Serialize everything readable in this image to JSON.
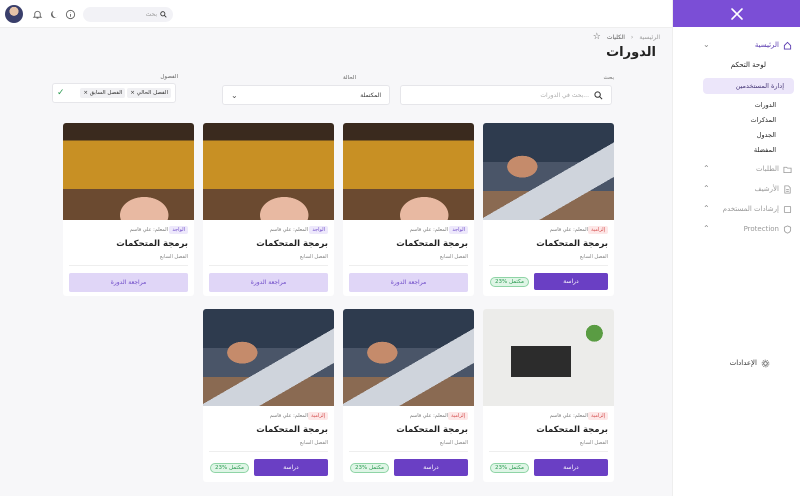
{
  "header": {
    "search_placeholder": "بحث",
    "icons": [
      "avatar",
      "bell-icon",
      "moon-icon",
      "info-icon",
      "search-icon"
    ]
  },
  "sidebar": {
    "home": "الرئيسية",
    "dashboard": "لوحة التحكم",
    "user_management": "إدارة المستخدمين",
    "sub_items": [
      "الدورات",
      "المذكرات",
      "الجدول",
      "المفضلة"
    ],
    "groups": [
      "الطلبات",
      "الأرشيف",
      "إرشادات المستخدم",
      "Protection"
    ],
    "settings": "الإعدادات"
  },
  "breadcrumb": [
    "الرئيسية",
    "الكليات"
  ],
  "page_title": "الدورات",
  "filters": {
    "search_label": "بحث",
    "search_placeholder": "بحث في الدورات...",
    "status_label": "الحالة",
    "status_value": "المكتملة",
    "season_label": "الفصول",
    "season_chips": [
      "الفصل الحالي",
      "الفصل السابق"
    ]
  },
  "cards": [
    {
      "badge": "إلزامية",
      "badge_type": "required",
      "teacher": "المعلم: علي قاسم",
      "title": "برمجة المتحكمات",
      "season": "الفصل السابع",
      "mode": "study",
      "button": "دراسة",
      "progress": "23% مكتمل",
      "image": "meeting"
    },
    {
      "badge": "الواجد",
      "badge_type": "completed",
      "teacher": "المعلم: علي قاسم",
      "title": "برمجة المتحكمات",
      "season": "الفصل السابع",
      "mode": "review",
      "button": "مراجعة الدورة",
      "image": "sweater"
    },
    {
      "badge": "الواجد",
      "badge_type": "completed",
      "teacher": "المعلم: علي قاسم",
      "title": "برمجة المتحكمات",
      "season": "الفصل السابع",
      "mode": "review",
      "button": "مراجعة الدورة",
      "image": "sweater"
    },
    {
      "badge": "الواجد",
      "badge_type": "completed",
      "teacher": "المعلم: علي قاسم",
      "title": "برمجة المتحكمات",
      "season": "الفصل السابع",
      "mode": "review",
      "button": "مراجعة الدورة",
      "image": "sweater"
    },
    {
      "badge": "إلزامية",
      "badge_type": "required",
      "teacher": "المعلم: علي قاسم",
      "title": "برمجة المتحكمات",
      "season": "الفصل السابع",
      "mode": "study",
      "button": "دراسة",
      "progress": "23% مكتمل",
      "image": "desk"
    },
    {
      "badge": "إلزامية",
      "badge_type": "required",
      "teacher": "المعلم: علي قاسم",
      "title": "برمجة المتحكمات",
      "season": "الفصل السابع",
      "mode": "study",
      "button": "دراسة",
      "progress": "23% مكتمل",
      "image": "meeting"
    },
    {
      "badge": "إلزامية",
      "badge_type": "required",
      "teacher": "المعلم: علي قاسم",
      "title": "برمجة المتحكمات",
      "season": "الفصل السابع",
      "mode": "study",
      "button": "دراسة",
      "progress": "23% مكتمل",
      "image": "meeting"
    }
  ],
  "colors": {
    "brand": "#7b4ed6",
    "primary_button": "#6a3fc4",
    "progress_green": "#2b9a51"
  }
}
